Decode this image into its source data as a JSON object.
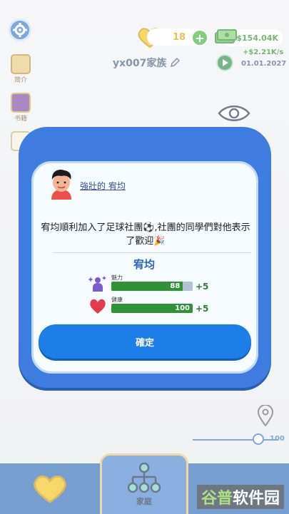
{
  "header": {
    "hearts": "18",
    "money": "$154.04K",
    "income": "+$2.21K/s",
    "family_name": "yx007家族",
    "date": "01.01.2027"
  },
  "sidebar": {
    "items": [
      {
        "label": "简介",
        "icon": "scroll-icon"
      },
      {
        "label": "书籍",
        "icon": "book-icon"
      },
      {
        "label": "",
        "icon": "document-icon"
      }
    ]
  },
  "map": {
    "slider_value": "100"
  },
  "bottom_nav": {
    "family_tab_label": "家庭"
  },
  "watermark": {
    "text_a": "谷普",
    "text_b": "软件园"
  },
  "dialog": {
    "person_link": "強壯的 宥均",
    "event_text": "宥均順利加入了足球社團⚽,社團的同學們對他表示了歡迎🎉",
    "character_name": "宥均",
    "stats": [
      {
        "label": "魅力",
        "value": 88,
        "display": "88",
        "delta": "+5",
        "icon": "charm-icon"
      },
      {
        "label": "健康",
        "value": 100,
        "display": "100",
        "delta": "+5",
        "icon": "heart-icon"
      }
    ],
    "confirm_label": "確定"
  },
  "colors": {
    "modal_blue": "#3f7ce0",
    "button_blue": "#1e7ee9",
    "stat_green": "#2f9336",
    "money_green": "#2f8d2f"
  }
}
